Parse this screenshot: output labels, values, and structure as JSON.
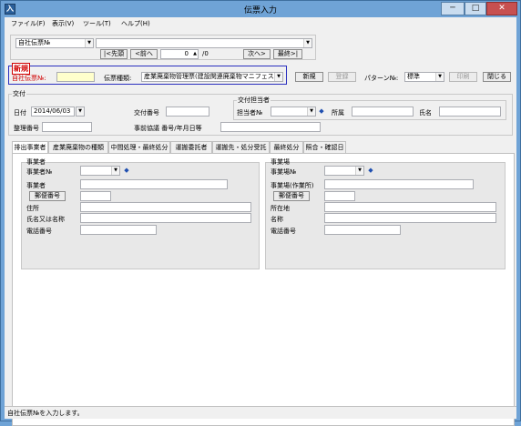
{
  "window": {
    "title": "伝票入力",
    "app_icon": "入",
    "min": "─",
    "max": "□",
    "close": "✕"
  },
  "menu": [
    "ファイル(F)",
    "表示(V)",
    "ツール(T)",
    "ヘルプ(H)"
  ],
  "nav": {
    "key_select": "自社伝票№",
    "search_value": "",
    "first": "|<先頭",
    "prev": "<前へ",
    "current": "0",
    "total": "/0",
    "next": "次へ>",
    "last": "最終>|"
  },
  "header": {
    "new_badge": "新規",
    "slip_no_label": "自社伝票№:",
    "slip_no_value": "",
    "type_label": "伝票種類:",
    "type_value": "産業廃棄物管理票(建設関連廃棄物マニフェスト)",
    "btn_new": "新規",
    "btn_register": "登録",
    "pattern_label": "パターン№:",
    "pattern_value": "標準",
    "btn_print": "印刷",
    "btn_close": "閉じる"
  },
  "issue": {
    "group": "交付",
    "date_label": "日付",
    "date_value": "2014/06/03",
    "issue_no_label": "交付番号",
    "issue_no_value": "",
    "seiri_label": "整理番号",
    "seiri_value": "",
    "jizen_label": "事前協議 番号/年月日等",
    "jizen_value": "",
    "person_group": "交付担当者",
    "tanto_no_label": "担当者№",
    "tanto_no_value": "",
    "busho_label": "所属",
    "busho_value": "",
    "shimei_label": "氏名",
    "shimei_value": ""
  },
  "tabs": [
    "排出事業者",
    "産業廃棄物の種類",
    "中間処理・最終処分",
    "運搬委託者",
    "運搬先・処分受託",
    "最終処分",
    "照合・確認日"
  ],
  "emitter": {
    "group": "事業者",
    "no_label": "事業者№",
    "name_label": "事業者",
    "zip_btn": "郵便番号",
    "addr_label": "住所",
    "person_label": "氏名又は名称",
    "tel_label": "電話番号"
  },
  "site": {
    "group": "事業場",
    "no_label": "事業場№",
    "name_label": "事業場(作業所)",
    "zip_btn": "郵便番号",
    "addr_label": "所在地",
    "person_label": "名称",
    "tel_label": "電話番号"
  },
  "status": "自社伝票№を入力します。"
}
